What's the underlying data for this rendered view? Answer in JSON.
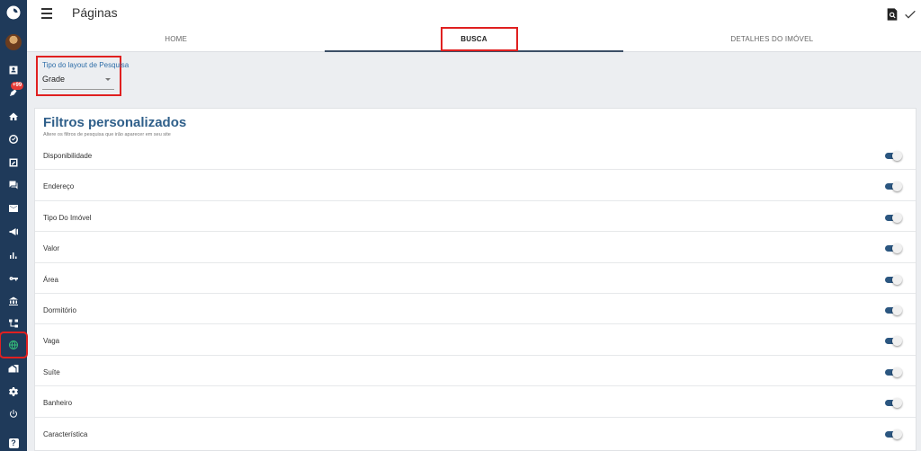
{
  "sidebar": {
    "notification_badge": "+99",
    "help_label": "?"
  },
  "header": {
    "title": "Páginas"
  },
  "tabs": [
    {
      "label": "HOME"
    },
    {
      "label": "BUSCA"
    },
    {
      "label": "DETALHES DO IMÓVEL"
    }
  ],
  "layout_select": {
    "label": "Tipo do layout de Pesquisa",
    "value": "Grade"
  },
  "filters_card": {
    "title": "Filtros personalizados",
    "subtitle": "Altere os filtros de pesquisa que irão aparecer em seu site",
    "items": [
      {
        "label": "Disponibilidade",
        "enabled": true
      },
      {
        "label": "Endereço",
        "enabled": true
      },
      {
        "label": "Tipo Do Imóvel",
        "enabled": true
      },
      {
        "label": "Valor",
        "enabled": true
      },
      {
        "label": "Área",
        "enabled": true
      },
      {
        "label": "Dormitório",
        "enabled": true
      },
      {
        "label": "Vaga",
        "enabled": true
      },
      {
        "label": "Suíte",
        "enabled": true
      },
      {
        "label": "Banheiro",
        "enabled": true
      },
      {
        "label": "Característica",
        "enabled": true
      }
    ]
  },
  "colors": {
    "sidebar_bg": "#1f3a5a",
    "accent": "#2f5f8a",
    "highlight": "#e02020",
    "toggle_on": "#2b5680"
  },
  "icons": [
    "logo-icon",
    "avatar",
    "contact-card-icon",
    "notifications-icon",
    "home-icon",
    "check-circle-icon",
    "edit-box-icon",
    "chat-icon",
    "mail-icon",
    "megaphone-icon",
    "bar-chart-icon",
    "key-icon",
    "bank-icon",
    "sitemap-icon",
    "globe-icon",
    "real-estate-icon",
    "gear-icon",
    "power-icon",
    "help-icon",
    "menu-icon",
    "preview-icon",
    "check-icon"
  ]
}
